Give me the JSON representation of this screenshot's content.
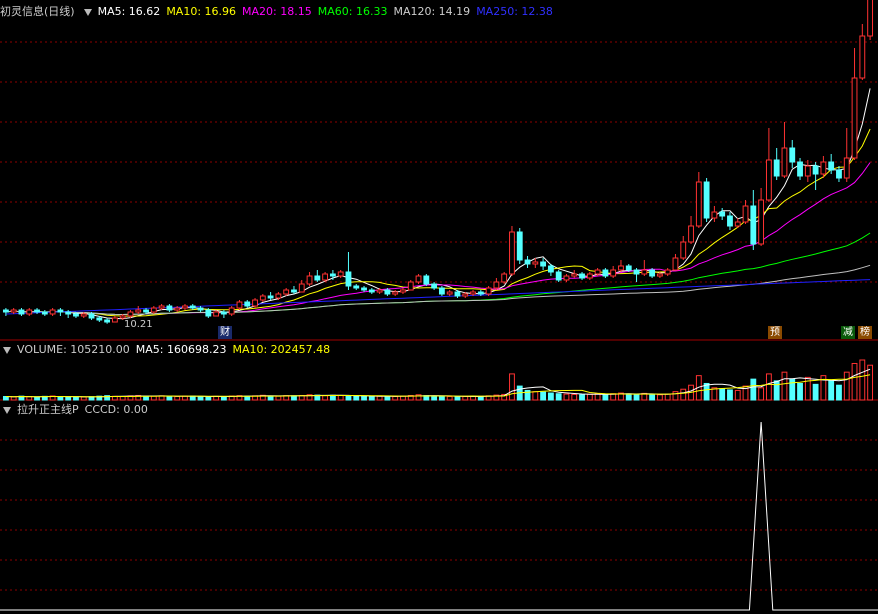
{
  "main_header": {
    "title": "初灵信息(日线)",
    "ma5": "MA5: 16.62",
    "ma10": "MA10: 16.96",
    "ma20": "MA20: 18.15",
    "ma60": "MA60: 16.33",
    "ma120": "MA120: 14.19",
    "ma250": "MA250: 12.38"
  },
  "volume_header": {
    "volume": "VOLUME: 105210.00",
    "ma5": "MA5: 160698.23",
    "ma10": "MA10: 202457.48"
  },
  "indicator_header": {
    "name": "拉升正主线P",
    "value": "CCCD: 0.00"
  },
  "labels": {
    "low_price": "10.21",
    "tag_cai": "财",
    "tag_yu": "预",
    "tag_jian": "减",
    "tag_bang": "榜"
  },
  "colors": {
    "up": "#ff3232",
    "down": "#54ffff",
    "ma5": "#ffffff",
    "ma10": "#ffff00",
    "ma20": "#ff00ff",
    "ma60": "#00ff00",
    "ma120": "#c0c0c0",
    "ma250": "#2020ff",
    "grid": "#8b0000",
    "indicator_line": "#ffffff"
  },
  "chart_data": {
    "type": "candlestick",
    "low_marker": 10.21,
    "candles": [
      [
        10.9,
        10.8,
        10.6,
        11.0
      ],
      [
        10.8,
        10.9,
        10.7,
        11.0
      ],
      [
        10.9,
        10.7,
        10.6,
        11.0
      ],
      [
        10.7,
        10.9,
        10.6,
        11.0
      ],
      [
        10.9,
        10.8,
        10.7,
        11.0
      ],
      [
        10.8,
        10.7,
        10.6,
        10.9
      ],
      [
        10.7,
        10.9,
        10.6,
        11.0
      ],
      [
        10.9,
        10.8,
        10.6,
        11.0
      ],
      [
        10.8,
        10.7,
        10.5,
        10.9
      ],
      [
        10.7,
        10.6,
        10.5,
        10.8
      ],
      [
        10.6,
        10.7,
        10.5,
        10.8
      ],
      [
        10.7,
        10.5,
        10.4,
        10.8
      ],
      [
        10.5,
        10.4,
        10.3,
        10.6
      ],
      [
        10.4,
        10.3,
        10.21,
        10.5
      ],
      [
        10.3,
        10.5,
        10.3,
        10.6
      ],
      [
        10.5,
        10.6,
        10.4,
        10.7
      ],
      [
        10.6,
        10.8,
        10.5,
        10.9
      ],
      [
        10.8,
        10.9,
        10.7,
        11.1
      ],
      [
        10.9,
        10.8,
        10.7,
        11.0
      ],
      [
        10.8,
        11.0,
        10.7,
        11.1
      ],
      [
        11.0,
        11.1,
        10.9,
        11.2
      ],
      [
        11.1,
        10.9,
        10.8,
        11.2
      ],
      [
        10.9,
        11.0,
        10.8,
        11.1
      ],
      [
        11.0,
        11.1,
        10.9,
        11.2
      ],
      [
        11.1,
        11.0,
        10.9,
        11.2
      ],
      [
        11.0,
        10.9,
        10.8,
        11.1
      ],
      [
        10.9,
        10.6,
        10.5,
        11.0
      ],
      [
        10.6,
        10.8,
        10.6,
        10.9
      ],
      [
        10.8,
        10.7,
        10.5,
        10.9
      ],
      [
        10.7,
        11.0,
        10.6,
        11.1
      ],
      [
        11.0,
        11.3,
        10.9,
        11.4
      ],
      [
        11.3,
        11.1,
        11.0,
        11.4
      ],
      [
        11.1,
        11.4,
        11.0,
        11.5
      ],
      [
        11.4,
        11.6,
        11.3,
        11.7
      ],
      [
        11.6,
        11.5,
        11.4,
        11.8
      ],
      [
        11.5,
        11.7,
        11.4,
        11.8
      ],
      [
        11.7,
        11.9,
        11.6,
        12.0
      ],
      [
        11.9,
        11.8,
        11.7,
        12.1
      ],
      [
        11.8,
        12.2,
        11.8,
        12.4
      ],
      [
        12.2,
        12.6,
        12.1,
        12.8
      ],
      [
        12.6,
        12.4,
        12.3,
        12.9
      ],
      [
        12.4,
        12.7,
        12.3,
        12.8
      ],
      [
        12.7,
        12.6,
        12.4,
        12.9
      ],
      [
        12.6,
        12.8,
        12.5,
        12.9
      ],
      [
        12.8,
        12.1,
        11.9,
        13.8
      ],
      [
        12.1,
        12.0,
        11.9,
        12.2
      ],
      [
        12.0,
        11.9,
        11.8,
        12.1
      ],
      [
        11.9,
        11.8,
        11.7,
        12.0
      ],
      [
        11.8,
        11.9,
        11.7,
        12.0
      ],
      [
        11.9,
        11.7,
        11.6,
        12.0
      ],
      [
        11.7,
        11.8,
        11.6,
        11.9
      ],
      [
        11.8,
        11.9,
        11.7,
        12.0
      ],
      [
        11.9,
        12.3,
        11.9,
        12.4
      ],
      [
        12.3,
        12.6,
        12.2,
        12.7
      ],
      [
        12.6,
        12.2,
        12.1,
        12.7
      ],
      [
        12.2,
        12.0,
        11.9,
        12.3
      ],
      [
        12.0,
        11.7,
        11.6,
        12.1
      ],
      [
        11.7,
        11.8,
        11.6,
        11.9
      ],
      [
        11.8,
        11.6,
        11.5,
        11.9
      ],
      [
        11.6,
        11.7,
        11.5,
        11.8
      ],
      [
        11.7,
        11.8,
        11.6,
        11.9
      ],
      [
        11.8,
        11.7,
        11.6,
        11.9
      ],
      [
        11.7,
        12.0,
        11.6,
        12.1
      ],
      [
        12.0,
        12.3,
        11.9,
        12.5
      ],
      [
        12.3,
        12.7,
        12.2,
        12.8
      ],
      [
        12.7,
        14.8,
        12.6,
        15.1
      ],
      [
        14.8,
        13.4,
        13.2,
        15.0
      ],
      [
        13.4,
        13.2,
        13.0,
        13.6
      ],
      [
        13.2,
        13.3,
        13.0,
        13.5
      ],
      [
        13.3,
        13.1,
        12.9,
        13.5
      ],
      [
        13.1,
        12.8,
        12.6,
        13.2
      ],
      [
        12.8,
        12.4,
        12.3,
        12.9
      ],
      [
        12.4,
        12.6,
        12.3,
        12.7
      ],
      [
        12.6,
        12.7,
        12.5,
        12.9
      ],
      [
        12.7,
        12.5,
        12.4,
        12.8
      ],
      [
        12.5,
        12.7,
        12.4,
        12.8
      ],
      [
        12.7,
        12.9,
        12.6,
        13.0
      ],
      [
        12.9,
        12.6,
        12.5,
        13.0
      ],
      [
        12.6,
        12.9,
        12.5,
        13.1
      ],
      [
        12.9,
        13.1,
        12.8,
        13.4
      ],
      [
        13.1,
        12.9,
        12.8,
        13.2
      ],
      [
        12.9,
        12.7,
        12.3,
        13.0
      ],
      [
        12.7,
        12.9,
        12.6,
        13.4
      ],
      [
        12.9,
        12.6,
        12.5,
        13.0
      ],
      [
        12.6,
        12.7,
        12.5,
        12.8
      ],
      [
        12.7,
        12.9,
        12.6,
        13.0
      ],
      [
        12.9,
        13.5,
        12.9,
        13.7
      ],
      [
        13.5,
        14.3,
        13.4,
        14.6
      ],
      [
        14.3,
        15.1,
        14.2,
        15.6
      ],
      [
        15.1,
        17.3,
        15.0,
        17.8
      ],
      [
        17.3,
        15.5,
        15.3,
        17.5
      ],
      [
        15.5,
        15.8,
        15.3,
        16.1
      ],
      [
        15.8,
        15.6,
        15.4,
        16.0
      ],
      [
        15.6,
        15.1,
        14.9,
        15.8
      ],
      [
        15.1,
        15.3,
        15.0,
        15.5
      ],
      [
        15.3,
        16.1,
        15.2,
        16.4
      ],
      [
        16.1,
        14.2,
        13.9,
        16.9
      ],
      [
        14.2,
        16.4,
        14.1,
        17.0
      ],
      [
        16.4,
        18.4,
        16.3,
        20.0
      ],
      [
        18.4,
        17.6,
        17.4,
        19.0
      ],
      [
        17.6,
        19.0,
        17.5,
        20.3
      ],
      [
        19.0,
        18.3,
        18.0,
        19.4
      ],
      [
        18.3,
        17.6,
        17.4,
        18.5
      ],
      [
        17.6,
        18.1,
        17.3,
        18.4
      ],
      [
        18.1,
        17.7,
        16.9,
        18.3
      ],
      [
        17.7,
        18.3,
        17.5,
        18.6
      ],
      [
        18.3,
        17.9,
        17.7,
        18.7
      ],
      [
        17.9,
        17.5,
        17.3,
        18.1
      ],
      [
        17.5,
        18.5,
        17.3,
        20.0
      ],
      [
        18.5,
        22.5,
        18.4,
        24.0
      ],
      [
        22.5,
        24.6,
        22.4,
        25.2
      ],
      [
        24.6,
        26.8,
        24.4,
        27.0
      ]
    ],
    "volume": [
      20,
      18,
      22,
      19,
      17,
      21,
      23,
      20,
      18,
      16,
      17,
      19,
      22,
      25,
      21,
      20,
      24,
      26,
      23,
      22,
      24,
      21,
      20,
      22,
      23,
      19,
      18,
      21,
      20,
      23,
      25,
      22,
      24,
      27,
      23,
      22,
      25,
      24,
      26,
      30,
      28,
      25,
      27,
      26,
      25,
      22,
      21,
      20,
      22,
      21,
      20,
      22,
      26,
      30,
      25,
      23,
      21,
      20,
      19,
      20,
      22,
      21,
      24,
      28,
      32,
      150,
      80,
      55,
      48,
      45,
      40,
      36,
      34,
      32,
      30,
      33,
      35,
      31,
      36,
      40,
      35,
      31,
      38,
      32,
      30,
      34,
      48,
      62,
      85,
      140,
      95,
      70,
      65,
      58,
      55,
      80,
      120,
      70,
      150,
      110,
      160,
      120,
      95,
      130,
      90,
      140,
      110,
      85,
      160,
      210,
      230,
      200
    ],
    "indicator": {
      "name": "CCCD",
      "spike_index": 97,
      "spike_value": 1.0
    }
  }
}
